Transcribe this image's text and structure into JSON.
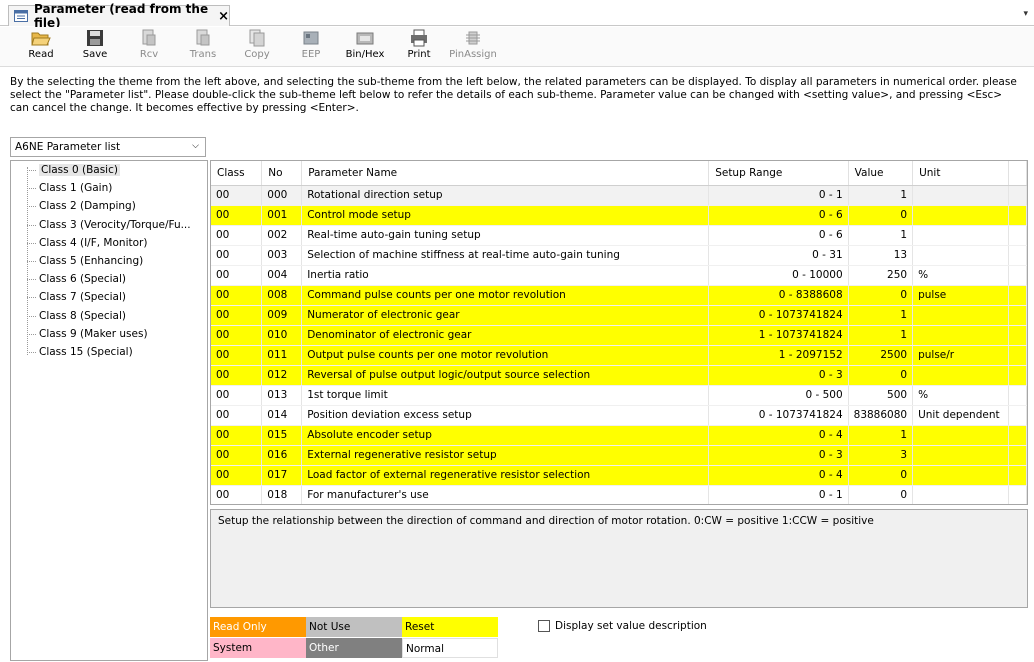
{
  "tab": {
    "title": "Parameter (read from the file)",
    "close": "×",
    "dropdown": "▾"
  },
  "toolbar": {
    "buttons": [
      {
        "label": "Read",
        "icon": "folder-open-icon",
        "enabled": true
      },
      {
        "label": "Save",
        "icon": "save-disk-icon",
        "enabled": true
      },
      {
        "label": "Rcv",
        "icon": "receive-icon",
        "enabled": false
      },
      {
        "label": "Trans",
        "icon": "transmit-icon",
        "enabled": false
      },
      {
        "label": "Copy",
        "icon": "copy-icon",
        "enabled": false
      },
      {
        "label": "EEP",
        "icon": "eeprom-icon",
        "enabled": false
      },
      {
        "label": "Bin/Hex",
        "icon": "bin-hex-icon",
        "enabled": true
      },
      {
        "label": "Print",
        "icon": "printer-icon",
        "enabled": true
      },
      {
        "label": "PinAssign",
        "icon": "pin-assign-icon",
        "enabled": false
      }
    ]
  },
  "description": "By the selecting the theme from the left above, and selecting the sub-theme from the left below, the related parameters can be displayed. To display all parameters in numerical order. please select the \"Parameter list\". Please double-click the sub-theme left below to refer the details of each sub-theme. Parameter value can be changed with <setting value>, and pressing <Esc> can cancel the change. It becomes effective by pressing <Enter>.",
  "theme_select": {
    "value": "A6NE Parameter list",
    "chevron": "⌵"
  },
  "tree": {
    "items": [
      {
        "label": "Class 0 (Basic)",
        "selected": true
      },
      {
        "label": "Class 1 (Gain)"
      },
      {
        "label": "Class 2 (Damping)"
      },
      {
        "label": "Class 3 (Verocity/Torque/Fu..."
      },
      {
        "label": "Class 4 (I/F, Monitor)"
      },
      {
        "label": "Class 5 (Enhancing)"
      },
      {
        "label": "Class 6 (Special)"
      },
      {
        "label": "Class 7 (Special)"
      },
      {
        "label": "Class 8 (Special)"
      },
      {
        "label": "Class 9 (Maker uses)"
      },
      {
        "label": "Class 15 (Special)"
      }
    ]
  },
  "table": {
    "headers": [
      "Class",
      "No",
      "Parameter Name",
      "Setup Range",
      "Value",
      "Unit"
    ],
    "rows": [
      {
        "cls": "00",
        "no": "000",
        "name": "Rotational direction setup",
        "range": "0 - 1",
        "value": "1",
        "unit": "",
        "state": "ro"
      },
      {
        "cls": "00",
        "no": "001",
        "name": "Control mode setup",
        "range": "0 - 6",
        "value": "0",
        "unit": "",
        "state": "reset"
      },
      {
        "cls": "00",
        "no": "002",
        "name": "Real-time auto-gain tuning setup",
        "range": "0 - 6",
        "value": "1",
        "unit": "",
        "state": "normal"
      },
      {
        "cls": "00",
        "no": "003",
        "name": "Selection of machine stiffness at real-time auto-gain tuning",
        "range": "0 - 31",
        "value": "13",
        "unit": "",
        "state": "normal"
      },
      {
        "cls": "00",
        "no": "004",
        "name": "Inertia ratio",
        "range": "0 - 10000",
        "value": "250",
        "unit": "%",
        "state": "normal"
      },
      {
        "cls": "00",
        "no": "008",
        "name": "Command pulse counts per one motor revolution",
        "range": "0 - 8388608",
        "value": "0",
        "unit": "pulse",
        "state": "reset"
      },
      {
        "cls": "00",
        "no": "009",
        "name": "Numerator of electronic gear",
        "range": "0 - 1073741824",
        "value": "1",
        "unit": "",
        "state": "reset"
      },
      {
        "cls": "00",
        "no": "010",
        "name": "Denominator of electronic gear",
        "range": "1 - 1073741824",
        "value": "1",
        "unit": "",
        "state": "reset"
      },
      {
        "cls": "00",
        "no": "011",
        "name": "Output pulse counts per one motor revolution",
        "range": "1 - 2097152",
        "value": "2500",
        "unit": "pulse/r",
        "state": "reset"
      },
      {
        "cls": "00",
        "no": "012",
        "name": "Reversal of pulse output logic/output source selection",
        "range": "0 - 3",
        "value": "0",
        "unit": "",
        "state": "reset"
      },
      {
        "cls": "00",
        "no": "013",
        "name": "1st torque limit",
        "range": "0 - 500",
        "value": "500",
        "unit": "%",
        "state": "normal"
      },
      {
        "cls": "00",
        "no": "014",
        "name": "Position deviation excess setup",
        "range": "0 - 1073741824",
        "value": "83886080",
        "unit": "Unit dependent",
        "state": "normal"
      },
      {
        "cls": "00",
        "no": "015",
        "name": "Absolute encoder setup",
        "range": "0 - 4",
        "value": "1",
        "unit": "",
        "state": "reset"
      },
      {
        "cls": "00",
        "no": "016",
        "name": "External regenerative resistor setup",
        "range": "0 - 3",
        "value": "3",
        "unit": "",
        "state": "reset"
      },
      {
        "cls": "00",
        "no": "017",
        "name": "Load factor of external regenerative resistor selection",
        "range": "0 - 4",
        "value": "0",
        "unit": "",
        "state": "reset"
      },
      {
        "cls": "00",
        "no": "018",
        "name": "For manufacturer's use",
        "range": "0 - 1",
        "value": "0",
        "unit": "",
        "state": "normal"
      }
    ]
  },
  "info_text": "Setup the relationship between the direction of command and direction of motor rotation. 0:CW = positive 1:CCW = positive",
  "legend": {
    "read_only": {
      "label": "Read Only",
      "color": "#ff9900"
    },
    "not_use": {
      "label": "Not Use",
      "color": "#c0c0c0"
    },
    "reset": {
      "label": "Reset",
      "color": "#ffff00"
    },
    "system": {
      "label": "System",
      "color": "#ffb6c8"
    },
    "other": {
      "label": "Other",
      "color": "#808080"
    },
    "normal": {
      "label": "Normal",
      "color": "#ffffff"
    }
  },
  "checkbox": {
    "label": "Display set value description",
    "checked": false
  }
}
